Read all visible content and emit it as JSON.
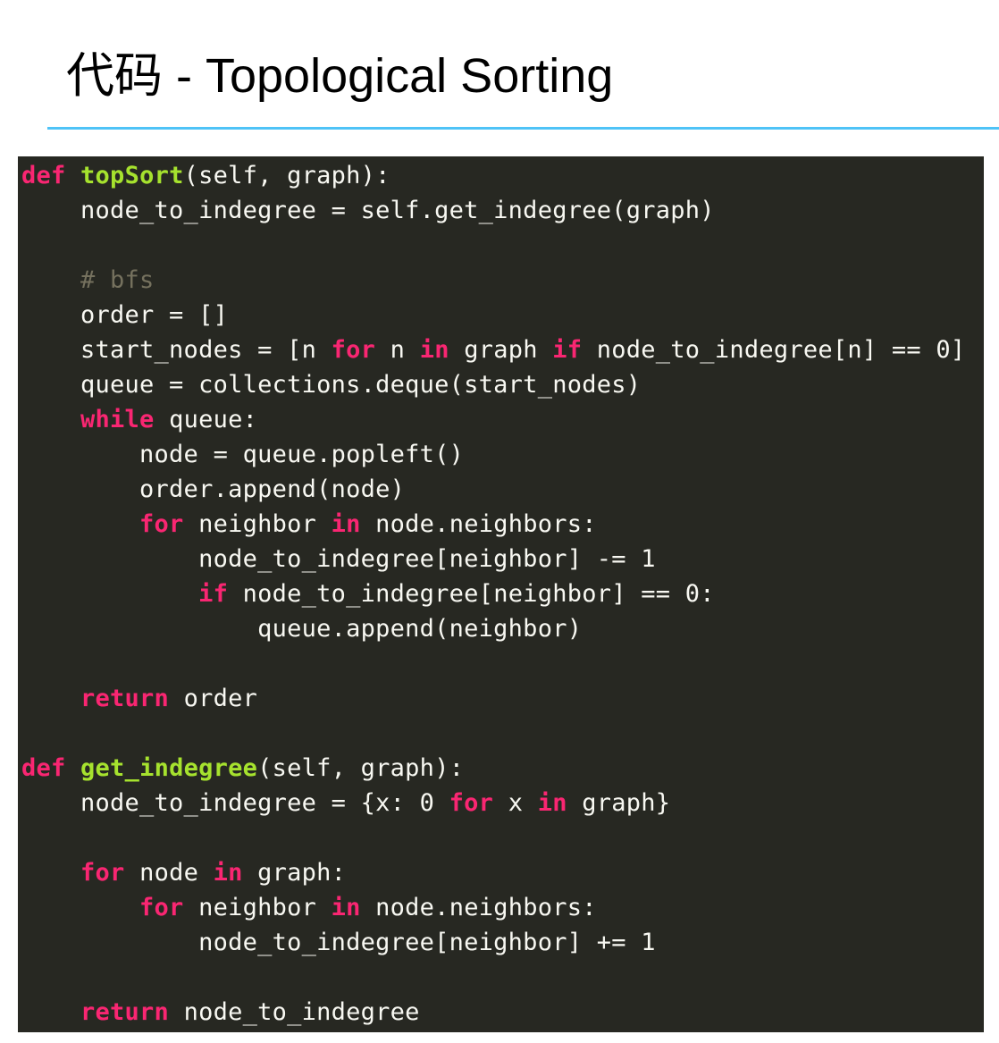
{
  "header": {
    "title": "代码 - Topological Sorting"
  },
  "colors": {
    "rule": "#4fc3f7",
    "code_background": "#272822",
    "plain": "#f8f8f2",
    "keyword": "#f92672",
    "function": "#a6e22e",
    "comment": "#75715e"
  },
  "code": {
    "lines": [
      [
        {
          "t": "def",
          "k": "kw"
        },
        {
          "t": " "
        },
        {
          "t": "topSort",
          "k": "fn"
        },
        {
          "t": "(self, graph):"
        }
      ],
      [
        {
          "t": "    node_to_indegree = self.get_indegree(graph)"
        }
      ],
      [],
      [
        {
          "t": "    "
        },
        {
          "t": "# bfs",
          "k": "cm"
        }
      ],
      [
        {
          "t": "    order = []"
        }
      ],
      [
        {
          "t": "    start_nodes = [n "
        },
        {
          "t": "for",
          "k": "kw"
        },
        {
          "t": " n "
        },
        {
          "t": "in",
          "k": "kw"
        },
        {
          "t": " graph "
        },
        {
          "t": "if",
          "k": "kw"
        },
        {
          "t": " node_to_indegree[n] == 0]"
        }
      ],
      [
        {
          "t": "    queue = collections.deque(start_nodes)"
        }
      ],
      [
        {
          "t": "    "
        },
        {
          "t": "while",
          "k": "kw"
        },
        {
          "t": " queue:"
        }
      ],
      [
        {
          "t": "        node = queue.popleft()"
        }
      ],
      [
        {
          "t": "        order.append(node)"
        }
      ],
      [
        {
          "t": "        "
        },
        {
          "t": "for",
          "k": "kw"
        },
        {
          "t": " neighbor "
        },
        {
          "t": "in",
          "k": "kw"
        },
        {
          "t": " node.neighbors:"
        }
      ],
      [
        {
          "t": "            node_to_indegree[neighbor] -= 1"
        }
      ],
      [
        {
          "t": "            "
        },
        {
          "t": "if",
          "k": "kw"
        },
        {
          "t": " node_to_indegree[neighbor] == 0:"
        }
      ],
      [
        {
          "t": "                queue.append(neighbor)"
        }
      ],
      [],
      [
        {
          "t": "    "
        },
        {
          "t": "return",
          "k": "kw"
        },
        {
          "t": " order"
        }
      ],
      [],
      [
        {
          "t": "def",
          "k": "kw"
        },
        {
          "t": " "
        },
        {
          "t": "get_indegree",
          "k": "fn"
        },
        {
          "t": "(self, graph):"
        }
      ],
      [
        {
          "t": "    node_to_indegree = {x: 0 "
        },
        {
          "t": "for",
          "k": "kw"
        },
        {
          "t": " x "
        },
        {
          "t": "in",
          "k": "kw"
        },
        {
          "t": " graph}"
        }
      ],
      [],
      [
        {
          "t": "    "
        },
        {
          "t": "for",
          "k": "kw"
        },
        {
          "t": " node "
        },
        {
          "t": "in",
          "k": "kw"
        },
        {
          "t": " graph:"
        }
      ],
      [
        {
          "t": "        "
        },
        {
          "t": "for",
          "k": "kw"
        },
        {
          "t": " neighbor "
        },
        {
          "t": "in",
          "k": "kw"
        },
        {
          "t": " node.neighbors:"
        }
      ],
      [
        {
          "t": "            node_to_indegree[neighbor] += 1"
        }
      ],
      [],
      [
        {
          "t": "    "
        },
        {
          "t": "return",
          "k": "kw"
        },
        {
          "t": " node_to_indegree"
        }
      ]
    ]
  }
}
